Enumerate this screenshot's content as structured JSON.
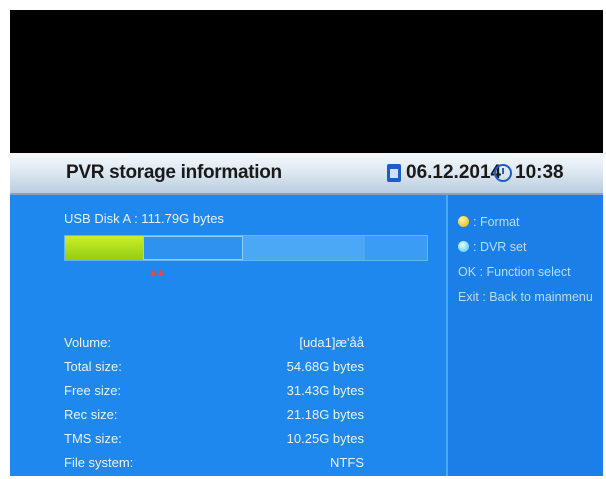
{
  "header": {
    "title": "PVR storage information",
    "date": "06.12.2014",
    "time": "10:38"
  },
  "disk": {
    "label": "USB Disk A : 111.79G bytes",
    "marker": "▲▲"
  },
  "usage": {
    "used_fraction": 0.21,
    "tms_fraction": 0.27,
    "free_fraction": 0.34
  },
  "info": [
    {
      "key": "Volume:",
      "value": "[uda1]æ'åå"
    },
    {
      "key": "Total size:",
      "value": "54.68G bytes"
    },
    {
      "key": "Free size:",
      "value": "31.43G bytes"
    },
    {
      "key": "Rec size:",
      "value": "21.18G bytes"
    },
    {
      "key": "TMS size:",
      "value": "10.25G bytes"
    },
    {
      "key": "File system:",
      "value": "NTFS"
    }
  ],
  "hints": [
    {
      "icon": "yellow-button-icon",
      "label": ": Format"
    },
    {
      "icon": "blue-button-icon",
      "label": ": DVR set"
    },
    {
      "key": "OK",
      "label": ": Function select"
    },
    {
      "key": "Exit",
      "label": ": Back to mainmenu"
    }
  ],
  "colors": {
    "panel": "#1e88ee",
    "used": "#b5e01f",
    "header": "#dfe9f2"
  }
}
